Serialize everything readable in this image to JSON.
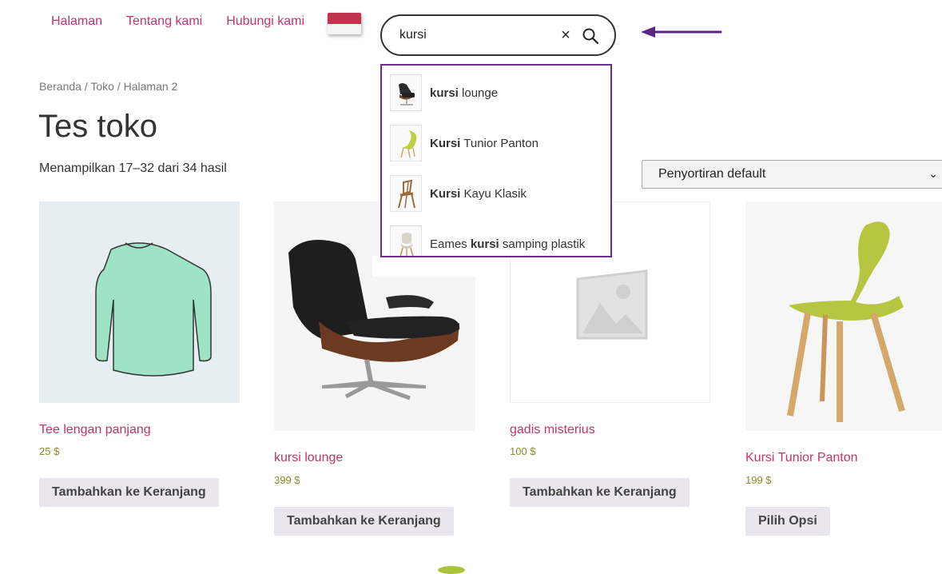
{
  "nav": {
    "items": [
      "Halaman",
      "Tentang kami",
      "Hubungi kami"
    ]
  },
  "search": {
    "value": "kursi",
    "clear_icon": "×"
  },
  "suggestions": [
    {
      "bold": "kursi",
      "rest": " lounge",
      "prefix": ""
    },
    {
      "bold": "Kursi",
      "rest": " Tunior Panton",
      "prefix": ""
    },
    {
      "bold": "Kursi",
      "rest": " Kayu Klasik",
      "prefix": ""
    },
    {
      "bold": "kursi",
      "rest": " samping plastik",
      "prefix": "Eames "
    }
  ],
  "breadcrumb": {
    "home": "Beranda",
    "shop": "Toko",
    "page": "Halaman 2",
    "sep": " / "
  },
  "page_title": "Tes toko",
  "result_count": "Menampilkan 17–32 dari 34 hasil",
  "sort": {
    "selected": "Penyortiran default"
  },
  "products": [
    {
      "name": "Tee lengan panjang",
      "price": "25 $",
      "button": "Tambahkan ke Keranjang"
    },
    {
      "name": "kursi lounge",
      "price": "399 $",
      "button": "Tambahkan ke Keranjang"
    },
    {
      "name": "gadis misterius",
      "price": "100 $",
      "button": "Tambahkan ke Keranjang"
    },
    {
      "name": "Kursi Tunior Panton",
      "price": "199 $",
      "button": "Pilih Opsi"
    }
  ],
  "colors": {
    "link": "#c2346b",
    "accent_border": "#6b2e8f",
    "price": "#8a8a2a",
    "button_bg": "#e9e6ed"
  },
  "icons": {
    "flag": "indonesia-flag-icon",
    "search": "search-icon",
    "clear": "close-icon",
    "arrow": "arrow-left-icon",
    "sort": "chevron-down-icon"
  }
}
